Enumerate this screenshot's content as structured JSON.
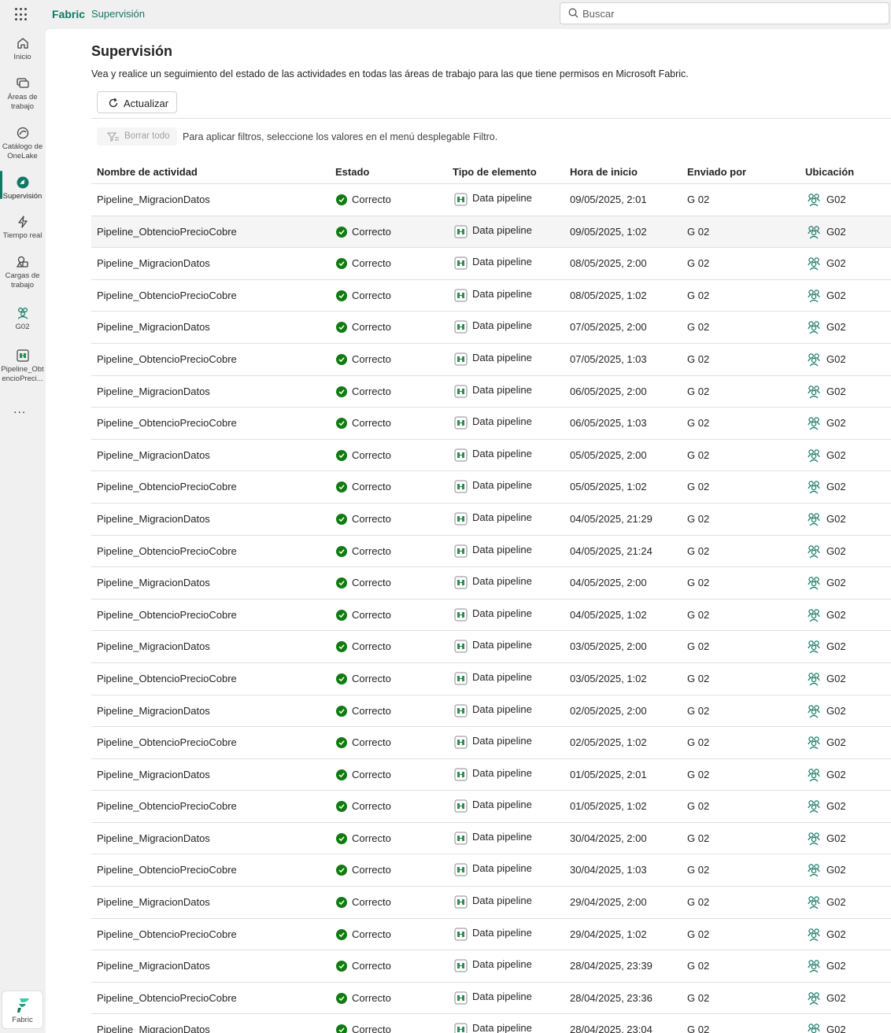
{
  "topbar": {
    "brand": "Fabric",
    "breadcrumb": "Supervisión",
    "search_placeholder": "Buscar"
  },
  "rail": {
    "items": [
      {
        "label_lines": [
          "Inicio"
        ],
        "icon": "home-icon"
      },
      {
        "label_lines": [
          "Áreas de",
          "trabajo"
        ],
        "icon": "workspaces-icon"
      },
      {
        "label_lines": [
          "Catálogo de",
          "OneLake"
        ],
        "icon": "onelake-catalog-icon"
      },
      {
        "label_lines": [
          "Supervisión"
        ],
        "icon": "monitor-icon"
      },
      {
        "label_lines": [
          "Tiempo real"
        ],
        "icon": "real-time-icon"
      },
      {
        "label_lines": [
          "Cargas de",
          "trabajo"
        ],
        "icon": "workloads-icon"
      },
      {
        "label_lines": [
          "G02"
        ],
        "icon": "workspace-icon"
      },
      {
        "label_lines": [
          "Pipeline_Obt",
          "encioPreci..."
        ],
        "icon": "pipeline-icon"
      }
    ],
    "more": "...",
    "footer_label": "Fabric"
  },
  "page": {
    "title": "Supervisión",
    "description": "Vea y realice un seguimiento del estado de las actividades en todas las áreas de trabajo para las que tiene permisos en Microsoft Fabric.",
    "refresh_label": "Actualizar",
    "clear_all_label": "Borrar todo",
    "filter_hint": "Para aplicar filtros, seleccione los valores en el menú desplegable Filtro."
  },
  "table": {
    "columns": [
      "Nombre de actividad",
      "Estado",
      "Tipo de elemento",
      "Hora de inicio",
      "Enviado por",
      "Ubicación"
    ],
    "rows": [
      [
        "Pipeline_MigracionDatos",
        "Correcto",
        "Data pipeline",
        "09/05/2025, 2:01",
        "G 02",
        "G02"
      ],
      [
        "Pipeline_ObtencioPrecioCobre",
        "Correcto",
        "Data pipeline",
        "09/05/2025, 1:02",
        "G 02",
        "G02"
      ],
      [
        "Pipeline_MigracionDatos",
        "Correcto",
        "Data pipeline",
        "08/05/2025, 2:00",
        "G 02",
        "G02"
      ],
      [
        "Pipeline_ObtencioPrecioCobre",
        "Correcto",
        "Data pipeline",
        "08/05/2025, 1:02",
        "G 02",
        "G02"
      ],
      [
        "Pipeline_MigracionDatos",
        "Correcto",
        "Data pipeline",
        "07/05/2025, 2:00",
        "G 02",
        "G02"
      ],
      [
        "Pipeline_ObtencioPrecioCobre",
        "Correcto",
        "Data pipeline",
        "07/05/2025, 1:03",
        "G 02",
        "G02"
      ],
      [
        "Pipeline_MigracionDatos",
        "Correcto",
        "Data pipeline",
        "06/05/2025, 2:00",
        "G 02",
        "G02"
      ],
      [
        "Pipeline_ObtencioPrecioCobre",
        "Correcto",
        "Data pipeline",
        "06/05/2025, 1:03",
        "G 02",
        "G02"
      ],
      [
        "Pipeline_MigracionDatos",
        "Correcto",
        "Data pipeline",
        "05/05/2025, 2:00",
        "G 02",
        "G02"
      ],
      [
        "Pipeline_ObtencioPrecioCobre",
        "Correcto",
        "Data pipeline",
        "05/05/2025, 1:02",
        "G 02",
        "G02"
      ],
      [
        "Pipeline_MigracionDatos",
        "Correcto",
        "Data pipeline",
        "04/05/2025, 21:29",
        "G 02",
        "G02"
      ],
      [
        "Pipeline_ObtencioPrecioCobre",
        "Correcto",
        "Data pipeline",
        "04/05/2025, 21:24",
        "G 02",
        "G02"
      ],
      [
        "Pipeline_MigracionDatos",
        "Correcto",
        "Data pipeline",
        "04/05/2025, 2:00",
        "G 02",
        "G02"
      ],
      [
        "Pipeline_ObtencioPrecioCobre",
        "Correcto",
        "Data pipeline",
        "04/05/2025, 1:02",
        "G 02",
        "G02"
      ],
      [
        "Pipeline_MigracionDatos",
        "Correcto",
        "Data pipeline",
        "03/05/2025, 2:00",
        "G 02",
        "G02"
      ],
      [
        "Pipeline_ObtencioPrecioCobre",
        "Correcto",
        "Data pipeline",
        "03/05/2025, 1:02",
        "G 02",
        "G02"
      ],
      [
        "Pipeline_MigracionDatos",
        "Correcto",
        "Data pipeline",
        "02/05/2025, 2:00",
        "G 02",
        "G02"
      ],
      [
        "Pipeline_ObtencioPrecioCobre",
        "Correcto",
        "Data pipeline",
        "02/05/2025, 1:02",
        "G 02",
        "G02"
      ],
      [
        "Pipeline_MigracionDatos",
        "Correcto",
        "Data pipeline",
        "01/05/2025, 2:01",
        "G 02",
        "G02"
      ],
      [
        "Pipeline_ObtencioPrecioCobre",
        "Correcto",
        "Data pipeline",
        "01/05/2025, 1:02",
        "G 02",
        "G02"
      ],
      [
        "Pipeline_MigracionDatos",
        "Correcto",
        "Data pipeline",
        "30/04/2025, 2:00",
        "G 02",
        "G02"
      ],
      [
        "Pipeline_ObtencioPrecioCobre",
        "Correcto",
        "Data pipeline",
        "30/04/2025, 1:03",
        "G 02",
        "G02"
      ],
      [
        "Pipeline_MigracionDatos",
        "Correcto",
        "Data pipeline",
        "29/04/2025, 2:00",
        "G 02",
        "G02"
      ],
      [
        "Pipeline_ObtencioPrecioCobre",
        "Correcto",
        "Data pipeline",
        "29/04/2025, 1:02",
        "G 02",
        "G02"
      ],
      [
        "Pipeline_MigracionDatos",
        "Correcto",
        "Data pipeline",
        "28/04/2025, 23:39",
        "G 02",
        "G02"
      ],
      [
        "Pipeline_ObtencioPrecioCobre",
        "Correcto",
        "Data pipeline",
        "28/04/2025, 23:36",
        "G 02",
        "G02"
      ],
      [
        "Pipeline_MigracionDatos",
        "Correcto",
        "Data pipeline",
        "28/04/2025, 23:04",
        "G 02",
        "G02"
      ]
    ]
  },
  "colors": {
    "accent": "#117865",
    "success": "#107c10",
    "pipeline": "#2e8b57"
  }
}
